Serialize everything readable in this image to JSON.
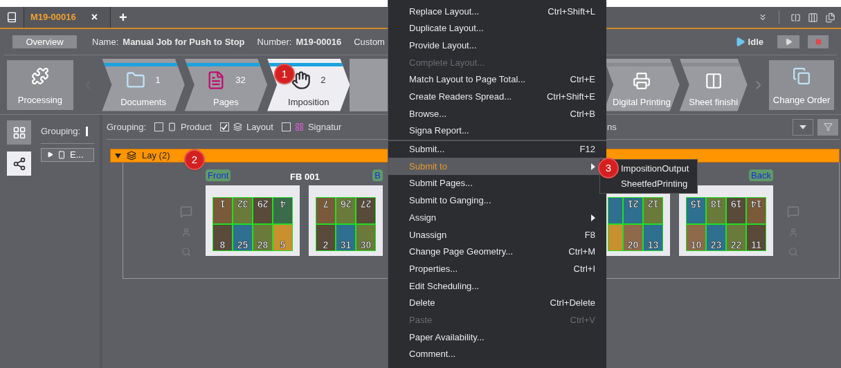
{
  "tabs": [
    {
      "label": "M19-00016",
      "close": "×",
      "selected": true
    }
  ],
  "new_tab": "+",
  "header": {
    "overview": "Overview",
    "fields": [
      {
        "label": "Name:",
        "value": "Manual Job for Push to Stop"
      },
      {
        "label": "Number:",
        "value": "M19-00016"
      }
    ],
    "cut_label": "Custom",
    "status": "Idle"
  },
  "workflow": {
    "processing": "Processing",
    "steps": [
      {
        "label": "Documents",
        "count": "1",
        "done": true,
        "selected": false
      },
      {
        "label": "Pages",
        "count": "32",
        "done": true,
        "selected": false
      },
      {
        "label": "Imposition",
        "count": "2",
        "done": true,
        "selected": true
      }
    ],
    "right_steps": [
      {
        "label": "Digital Printing",
        "done": false,
        "selected": false
      },
      {
        "label": "Sheet finishi",
        "done": false,
        "selected": false
      }
    ],
    "change_order": "Change Order"
  },
  "sidebar": {
    "grouping": "Grouping:",
    "tree_item": "E..."
  },
  "grouping_bar": {
    "label": "Grouping:",
    "options": [
      {
        "label": "Product",
        "checked": false
      },
      {
        "label": "Layout",
        "checked": true
      },
      {
        "label": "Signatur",
        "checked": false
      }
    ],
    "cut_text": "ns"
  },
  "group": {
    "title": "Lay (2)",
    "expanded": true
  },
  "sheets_left": {
    "name": "FB 001",
    "sides": [
      {
        "label": "Front",
        "kind": "front",
        "rows": [
          {
            "flipped": true,
            "pages": [
              "1",
              "32",
              "29",
              "4"
            ]
          },
          {
            "flipped": false,
            "pages": [
              "8",
              "25",
              "28",
              "5"
            ]
          }
        ]
      },
      {
        "label": "B",
        "kind": "back",
        "rows": [
          {
            "flipped": true,
            "pages": [
              "7",
              "26",
              "27"
            ]
          },
          {
            "flipped": false,
            "pages": [
              "2",
              "31",
              "30"
            ]
          }
        ]
      }
    ]
  },
  "sheets_right": {
    "sides": [
      {
        "kind": "front",
        "rows": [
          {
            "flipped": true,
            "pages": [
              "21",
              "12"
            ]
          },
          {
            "flipped": false,
            "pages": [
              "20",
              "13"
            ]
          }
        ]
      },
      {
        "label": "Back",
        "kind": "back",
        "rows": [
          {
            "flipped": true,
            "pages": [
              "15",
              "18",
              "19",
              "14"
            ]
          },
          {
            "flipped": false,
            "pages": [
              "10",
              "23",
              "22",
              "11"
            ]
          }
        ]
      }
    ]
  },
  "menu": [
    {
      "label": "Replace Layout...",
      "shortcut": "Ctrl+Shift+L",
      "disabled": false,
      "selected": false
    },
    {
      "label": "Duplicate Layout...",
      "disabled": false,
      "selected": false
    },
    {
      "label": "Provide Layout...",
      "disabled": false,
      "selected": false
    },
    {
      "label": "Complete Layout...",
      "disabled": true,
      "selected": false
    },
    {
      "label": "Match Layout to Page Total...",
      "shortcut": "Ctrl+E",
      "disabled": false,
      "selected": false
    },
    {
      "label": "Create Readers Spread...",
      "shortcut": "Ctrl+Shift+E",
      "disabled": false,
      "selected": false
    },
    {
      "label": "Browse...",
      "shortcut": "Ctrl+B",
      "disabled": false,
      "selected": false
    },
    {
      "label": "Signa Report...",
      "disabled": false,
      "selected": false
    },
    {
      "label": "Submit...",
      "shortcut": "F12",
      "disabled": false,
      "selected": false,
      "separator_before": true
    },
    {
      "label": "Submit to",
      "disabled": false,
      "selected": true,
      "submenu": true
    },
    {
      "label": "Submit Pages...",
      "disabled": false,
      "selected": false
    },
    {
      "label": "Submit to Ganging...",
      "disabled": false,
      "selected": false
    },
    {
      "label": "Assign",
      "disabled": false,
      "selected": false,
      "submenu": true
    },
    {
      "label": "Unassign",
      "shortcut": "F8",
      "disabled": false,
      "selected": false
    },
    {
      "label": "Change Page Geometry...",
      "shortcut": "Ctrl+M",
      "disabled": false,
      "selected": false
    },
    {
      "label": "Properties...",
      "shortcut": "Ctrl+I",
      "disabled": false,
      "selected": false
    },
    {
      "label": "Edit Scheduling...",
      "disabled": false,
      "selected": false
    },
    {
      "label": "Delete",
      "shortcut": "Ctrl+Delete",
      "disabled": false,
      "selected": false
    },
    {
      "label": "Paste",
      "shortcut": "Ctrl+V",
      "disabled": true,
      "selected": false
    },
    {
      "label": "Paper Availability...",
      "disabled": false,
      "selected": false
    },
    {
      "label": "Comment...",
      "disabled": false,
      "selected": false
    }
  ],
  "submenu": [
    "ImpositionOutput",
    "SheetfedPrinting"
  ],
  "callouts": [
    "1",
    "2",
    "3"
  ]
}
